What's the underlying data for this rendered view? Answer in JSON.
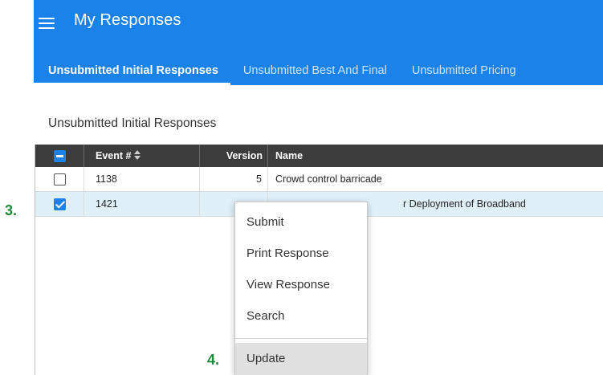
{
  "app": {
    "title": "My Responses",
    "menu_icon": "hamburger-menu-icon",
    "accent_color": "#1a82e8"
  },
  "tabs": [
    {
      "label": "Unsubmitted Initial Responses",
      "active": true
    },
    {
      "label": "Unsubmitted Best And Final",
      "active": false
    },
    {
      "label": "Unsubmitted Pricing",
      "active": false
    }
  ],
  "section": {
    "title": "Unsubmitted Initial Responses"
  },
  "table": {
    "columns": [
      "Event #",
      "Version",
      "Name"
    ],
    "rows": [
      {
        "event": "1138",
        "version": "5",
        "name": "Crowd control barricade",
        "checked": false
      },
      {
        "event": "1421",
        "version": "",
        "name": "r Deployment of Broadband",
        "checked": true
      }
    ]
  },
  "annotations": {
    "step3": "3.",
    "step4": "4."
  },
  "context_menu": {
    "items": [
      "Submit",
      "Print Response",
      "View Response",
      "Search",
      "Update"
    ]
  }
}
